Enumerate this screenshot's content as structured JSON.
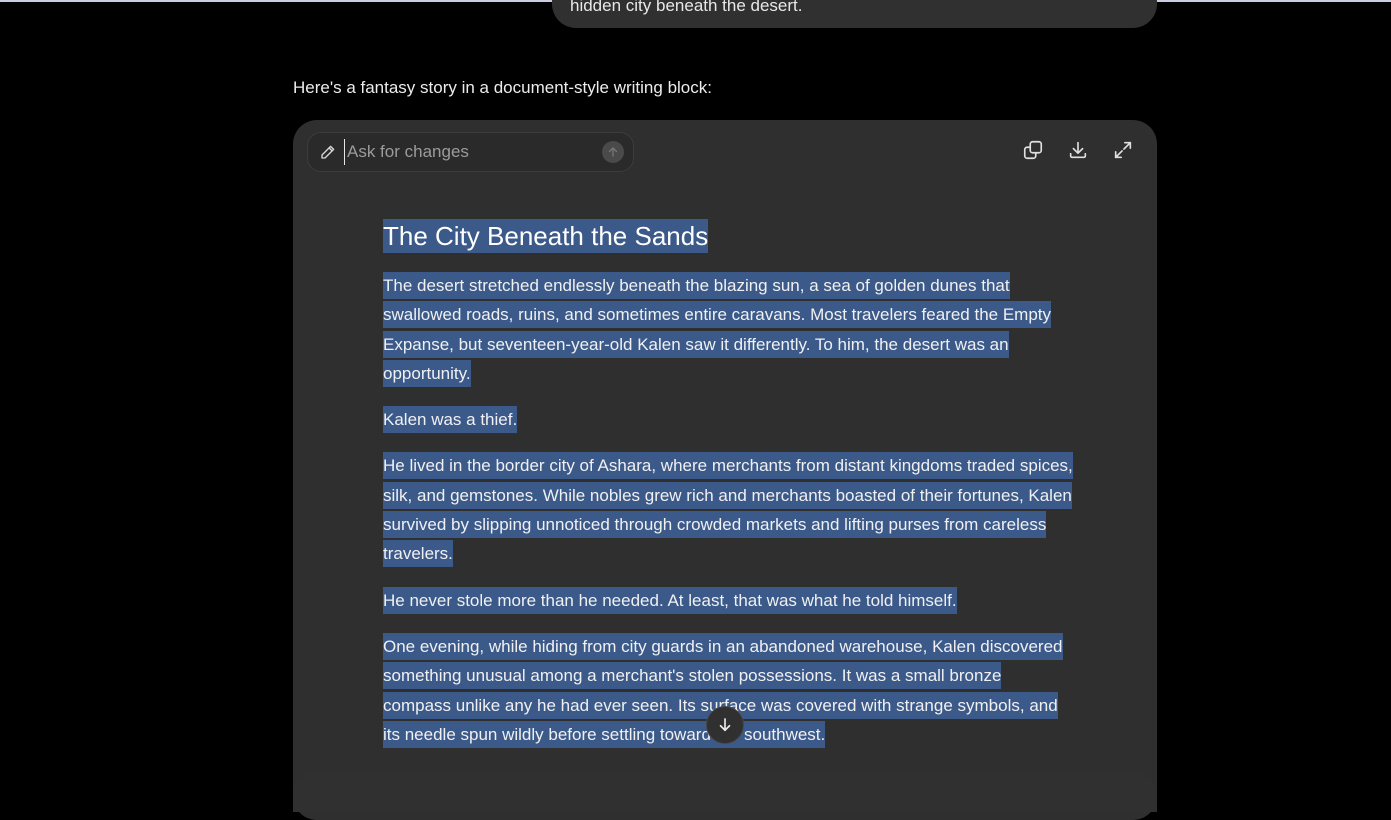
{
  "conversation": {
    "user_message_tail": "hidden city beneath the desert.",
    "assistant_intro": "Here's a fantasy story in a document-style writing block:"
  },
  "canvas": {
    "ask_placeholder": "Ask for changes",
    "toolbar": {
      "copy_icon": "copy-icon",
      "download_icon": "download-icon",
      "expand_icon": "expand-icon"
    },
    "document": {
      "title": "The City Beneath the Sands",
      "paragraphs": [
        "The desert stretched endlessly beneath the blazing sun, a sea of golden dunes that swallowed roads, ruins, and sometimes entire caravans. Most travelers feared the Empty Expanse, but seventeen-year-old Kalen saw it differently. To him, the desert was an opportunity.",
        "Kalen was a thief.",
        "He lived in the border city of Ashara, where merchants from distant kingdoms traded spices, silk, and gemstones. While nobles grew rich and merchants boasted of their fortunes, Kalen survived by slipping unnoticed through crowded markets and lifting purses from careless travelers.",
        "He never stole more than he needed. At least, that was what he told himself.",
        "One evening, while hiding from city guards in an abandoned warehouse, Kalen discovered something unusual among a merchant's stolen possessions. It was a small bronze compass unlike any he had ever seen. Its surface was covered with strange symbols, and its needle spun wildly before settling toward the southwest."
      ]
    }
  },
  "colors": {
    "background": "#000000",
    "card": "#2f2f2f",
    "selection": "#3b5a8a"
  }
}
